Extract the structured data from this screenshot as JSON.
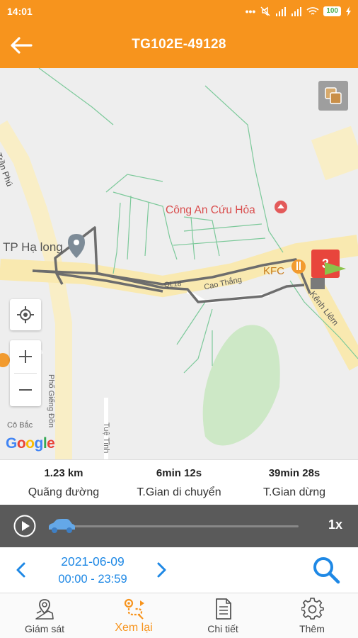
{
  "status_bar": {
    "time": "14:01",
    "battery": "100"
  },
  "header": {
    "title": "TG102E-49128"
  },
  "map": {
    "labels": {
      "tran_phu": "Trần Phú",
      "tp_ha_long": "TP Hạ long",
      "cong_an": "Công An Cứu Hỏa",
      "kfc": "KFC",
      "cao_thang": "Cao Thắng",
      "ql18": "QL18",
      "kenh_liem": "Kênh Liêm",
      "pho_giang_don": "Phố Giếng Đồn",
      "tue_tinh": "Tuệ Tĩnh",
      "co_bac": "Cô Bắc",
      "end_marker": "3"
    },
    "google": [
      "G",
      "o",
      "o",
      "g",
      "l",
      "e"
    ],
    "google_colors": [
      "#4285F4",
      "#EA4335",
      "#FBBC05",
      "#4285F4",
      "#34A853",
      "#EA4335"
    ],
    "route_color": "#6d6d6d"
  },
  "stats": {
    "distance": {
      "value": "1.23 km",
      "label": "Quãng đường"
    },
    "moving": {
      "value": "6min 12s",
      "label": "T.Gian di chuyển"
    },
    "stopped": {
      "value": "39min 28s",
      "label": "T.Gian dừng"
    }
  },
  "player": {
    "progress": 0,
    "speed": "1x"
  },
  "date": {
    "day": "2021-06-09",
    "range": "00:00 - 23:59"
  },
  "tabs": [
    {
      "label": "Giám sát",
      "icon": "map-pin-icon"
    },
    {
      "label": "Xem lại",
      "icon": "route-icon"
    },
    {
      "label": "Chi tiết",
      "icon": "document-icon"
    },
    {
      "label": "Thêm",
      "icon": "gear-icon"
    }
  ],
  "colors": {
    "primary": "#f7941d",
    "accent_blue": "#1e88e5",
    "end_marker": "#e8453c",
    "start_flag": "#8bc34a"
  }
}
